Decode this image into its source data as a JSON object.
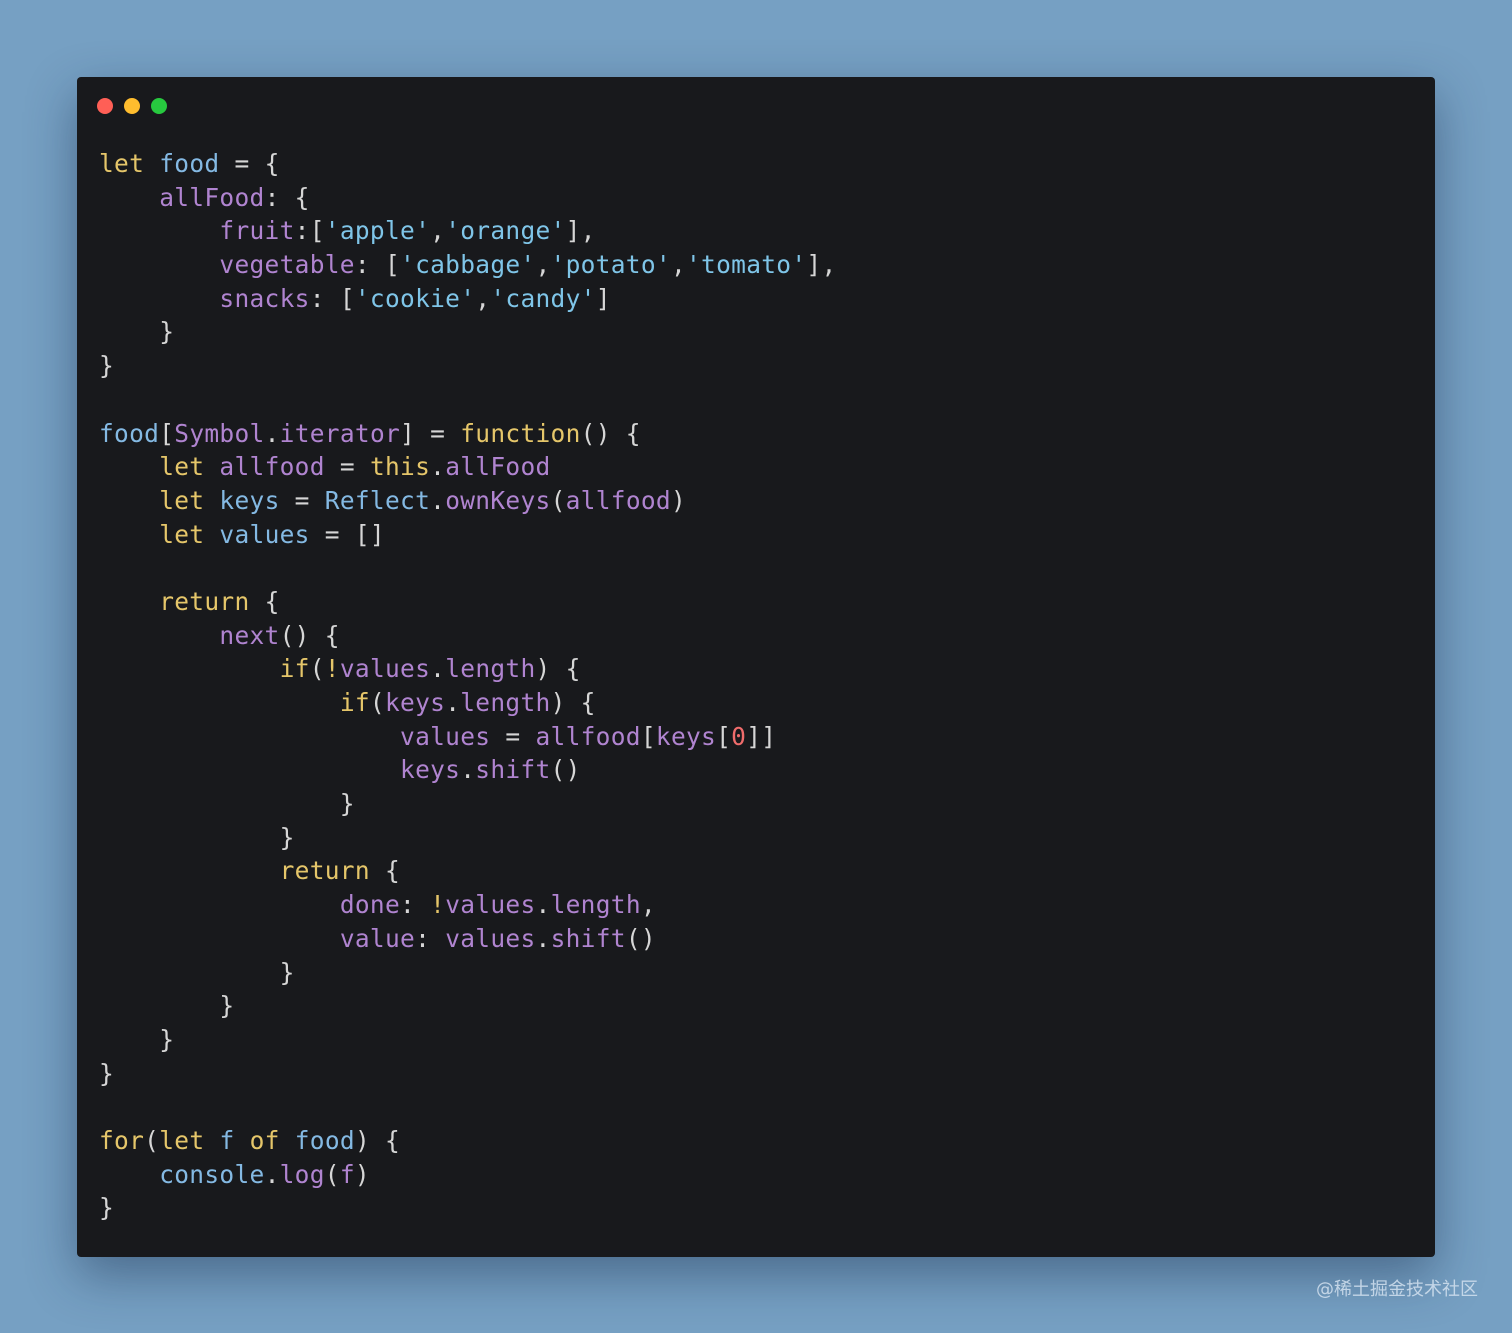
{
  "window": {
    "controls": [
      {
        "name": "close",
        "color": "#ff5f56"
      },
      {
        "name": "minimize",
        "color": "#ffbd2e"
      },
      {
        "name": "maximize",
        "color": "#27c93f"
      }
    ]
  },
  "syntax_colors": {
    "keyword": "#e5c66a",
    "identifier": "#84b9e3",
    "property": "#b084d0",
    "string": "#7fc5e8",
    "number": "#f06c6c",
    "punctuation": "#d6d6d6"
  },
  "code": [
    [
      [
        "k",
        "let"
      ],
      [
        "p",
        " "
      ],
      [
        "i",
        "food"
      ],
      [
        "p",
        " = {"
      ]
    ],
    [
      [
        "p",
        "    "
      ],
      [
        "m",
        "allFood"
      ],
      [
        "p",
        ": {"
      ]
    ],
    [
      [
        "p",
        "        "
      ],
      [
        "m",
        "fruit"
      ],
      [
        "p",
        ":["
      ],
      [
        "s",
        "'apple'"
      ],
      [
        "p",
        ","
      ],
      [
        "s",
        "'orange'"
      ],
      [
        "p",
        "],"
      ]
    ],
    [
      [
        "p",
        "        "
      ],
      [
        "m",
        "vegetable"
      ],
      [
        "p",
        ": ["
      ],
      [
        "s",
        "'cabbage'"
      ],
      [
        "p",
        ","
      ],
      [
        "s",
        "'potato'"
      ],
      [
        "p",
        ","
      ],
      [
        "s",
        "'tomato'"
      ],
      [
        "p",
        "],"
      ]
    ],
    [
      [
        "p",
        "        "
      ],
      [
        "m",
        "snacks"
      ],
      [
        "p",
        ": ["
      ],
      [
        "s",
        "'cookie'"
      ],
      [
        "p",
        ","
      ],
      [
        "s",
        "'candy'"
      ],
      [
        "p",
        "]"
      ]
    ],
    [
      [
        "p",
        "    }"
      ]
    ],
    [
      [
        "p",
        "}"
      ]
    ],
    [],
    [
      [
        "i",
        "food"
      ],
      [
        "p",
        "["
      ],
      [
        "m",
        "Symbol"
      ],
      [
        "p",
        "."
      ],
      [
        "m",
        "iterator"
      ],
      [
        "p",
        "] = "
      ],
      [
        "k",
        "function"
      ],
      [
        "p",
        "() {"
      ]
    ],
    [
      [
        "p",
        "    "
      ],
      [
        "k",
        "let"
      ],
      [
        "p",
        " "
      ],
      [
        "m",
        "allfood"
      ],
      [
        "p",
        " = "
      ],
      [
        "k",
        "this"
      ],
      [
        "p",
        "."
      ],
      [
        "m",
        "allFood"
      ]
    ],
    [
      [
        "p",
        "    "
      ],
      [
        "k",
        "let"
      ],
      [
        "p",
        " "
      ],
      [
        "i",
        "keys"
      ],
      [
        "p",
        " = "
      ],
      [
        "i",
        "Reflect"
      ],
      [
        "p",
        "."
      ],
      [
        "m",
        "ownKeys"
      ],
      [
        "p",
        "("
      ],
      [
        "m",
        "allfood"
      ],
      [
        "p",
        ")"
      ]
    ],
    [
      [
        "p",
        "    "
      ],
      [
        "k",
        "let"
      ],
      [
        "p",
        " "
      ],
      [
        "i",
        "values"
      ],
      [
        "p",
        " = []"
      ]
    ],
    [],
    [
      [
        "p",
        "    "
      ],
      [
        "k",
        "return"
      ],
      [
        "p",
        " {"
      ]
    ],
    [
      [
        "p",
        "        "
      ],
      [
        "m",
        "next"
      ],
      [
        "p",
        "() {"
      ]
    ],
    [
      [
        "p",
        "            "
      ],
      [
        "k",
        "if"
      ],
      [
        "p",
        "("
      ],
      [
        "k",
        "!"
      ],
      [
        "m",
        "values"
      ],
      [
        "p",
        "."
      ],
      [
        "m",
        "length"
      ],
      [
        "p",
        ") {"
      ]
    ],
    [
      [
        "p",
        "                "
      ],
      [
        "k",
        "if"
      ],
      [
        "p",
        "("
      ],
      [
        "m",
        "keys"
      ],
      [
        "p",
        "."
      ],
      [
        "m",
        "length"
      ],
      [
        "p",
        ") {"
      ]
    ],
    [
      [
        "p",
        "                    "
      ],
      [
        "m",
        "values"
      ],
      [
        "p",
        " = "
      ],
      [
        "m",
        "allfood"
      ],
      [
        "p",
        "["
      ],
      [
        "m",
        "keys"
      ],
      [
        "p",
        "["
      ],
      [
        "n",
        "0"
      ],
      [
        "p",
        "]]"
      ]
    ],
    [
      [
        "p",
        "                    "
      ],
      [
        "m",
        "keys"
      ],
      [
        "p",
        "."
      ],
      [
        "m",
        "shift"
      ],
      [
        "p",
        "()"
      ]
    ],
    [
      [
        "p",
        "                }"
      ]
    ],
    [
      [
        "p",
        "            }"
      ]
    ],
    [
      [
        "p",
        "            "
      ],
      [
        "k",
        "return"
      ],
      [
        "p",
        " {"
      ]
    ],
    [
      [
        "p",
        "                "
      ],
      [
        "m",
        "done"
      ],
      [
        "p",
        ": "
      ],
      [
        "k",
        "!"
      ],
      [
        "m",
        "values"
      ],
      [
        "p",
        "."
      ],
      [
        "m",
        "length"
      ],
      [
        "p",
        ","
      ]
    ],
    [
      [
        "p",
        "                "
      ],
      [
        "m",
        "value"
      ],
      [
        "p",
        ": "
      ],
      [
        "m",
        "values"
      ],
      [
        "p",
        "."
      ],
      [
        "m",
        "shift"
      ],
      [
        "p",
        "()"
      ]
    ],
    [
      [
        "p",
        "            }"
      ]
    ],
    [
      [
        "p",
        "        }"
      ]
    ],
    [
      [
        "p",
        "    }"
      ]
    ],
    [
      [
        "p",
        "}"
      ]
    ],
    [],
    [
      [
        "k",
        "for"
      ],
      [
        "p",
        "("
      ],
      [
        "k",
        "let"
      ],
      [
        "p",
        " "
      ],
      [
        "i",
        "f"
      ],
      [
        "p",
        " "
      ],
      [
        "k",
        "of"
      ],
      [
        "p",
        " "
      ],
      [
        "i",
        "food"
      ],
      [
        "p",
        ") {"
      ]
    ],
    [
      [
        "p",
        "    "
      ],
      [
        "i",
        "console"
      ],
      [
        "p",
        "."
      ],
      [
        "m",
        "log"
      ],
      [
        "p",
        "("
      ],
      [
        "m",
        "f"
      ],
      [
        "p",
        ")"
      ]
    ],
    [
      [
        "p",
        "}"
      ]
    ]
  ],
  "watermark": "@稀土掘金技术社区"
}
